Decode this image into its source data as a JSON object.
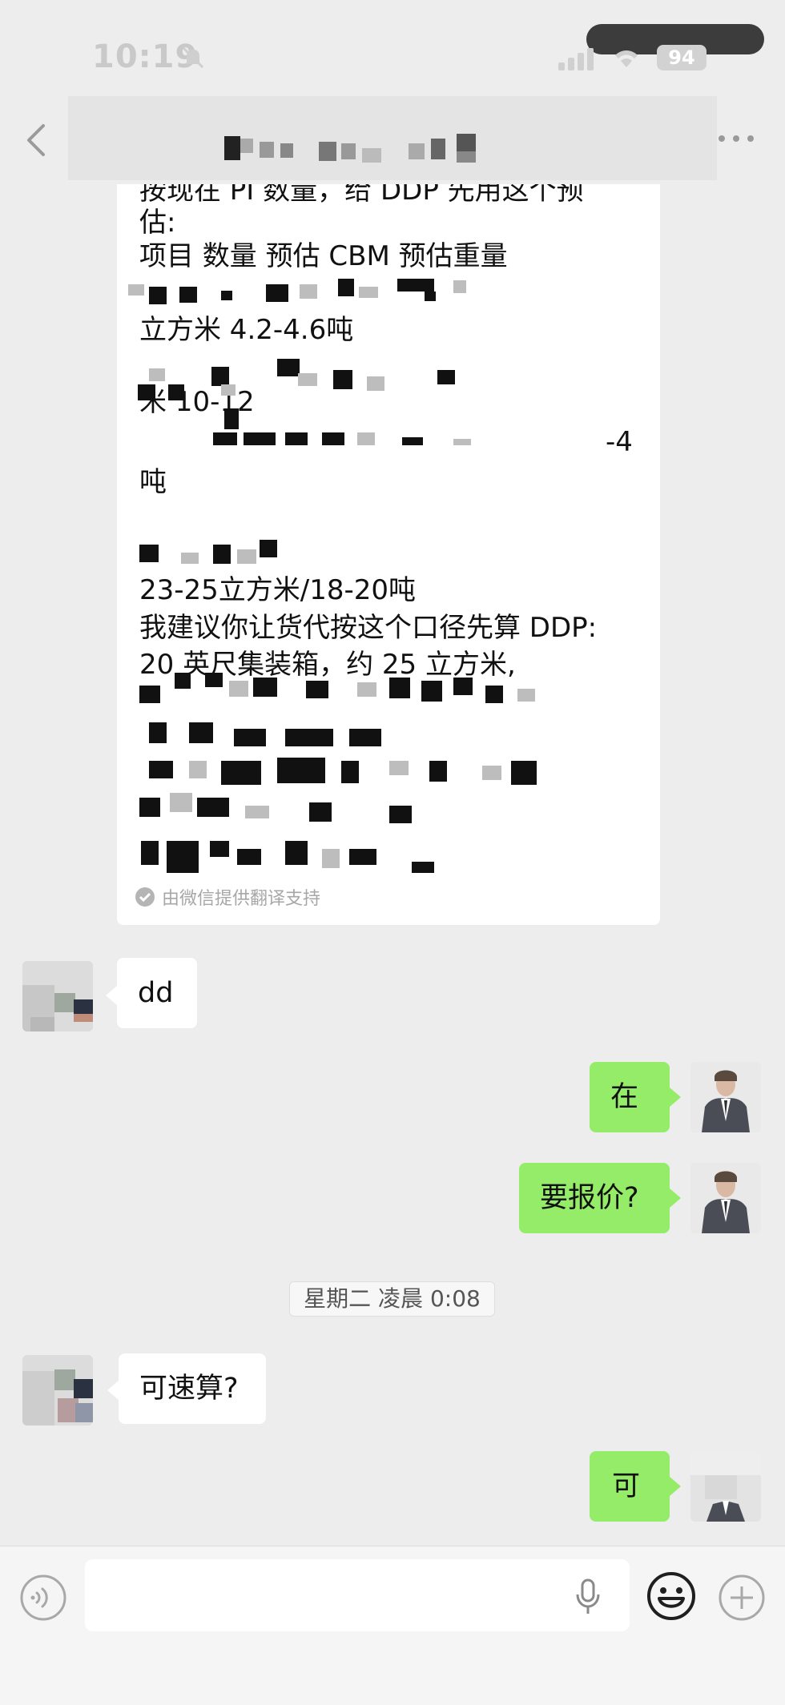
{
  "status_bar": {
    "time": "10:19",
    "battery": "94"
  },
  "chat": {
    "translation_lines": [
      "按现在 PI 数量，给 DDP 先用这个预",
      "估:",
      "项目      数量      预估 CBM  预估重量",
      "立方米 4.2-4.6吨",
      "米 10-12",
      "-4",
      "吨",
      "23-25立方米/18-20吨",
      "我建议你让货代按这个口径先算 DDP:",
      "20 英尺集装箱，约 25 立方米,"
    ],
    "translation_support": "由微信提供翻译支持",
    "messages": [
      {
        "side": "left",
        "text": "dd"
      },
      {
        "side": "right",
        "text": "在"
      },
      {
        "side": "right",
        "text": "要报价?"
      },
      {
        "side": "left",
        "text": "可速算?"
      },
      {
        "side": "right",
        "text": "可"
      }
    ],
    "timestamp": "星期二 凌晨 0:08"
  },
  "input_bar": {
    "placeholder": ""
  },
  "icons": {
    "back": "chevron-left-icon",
    "more": "more-dots-icon",
    "voice": "voice-icon",
    "mic": "microphone-icon",
    "emoji": "emoji-icon",
    "plus": "plus-icon",
    "check": "check-circle-icon"
  },
  "colors": {
    "background": "#ededed",
    "bubble_self": "#95ec69",
    "bubble_other": "#ffffff"
  }
}
